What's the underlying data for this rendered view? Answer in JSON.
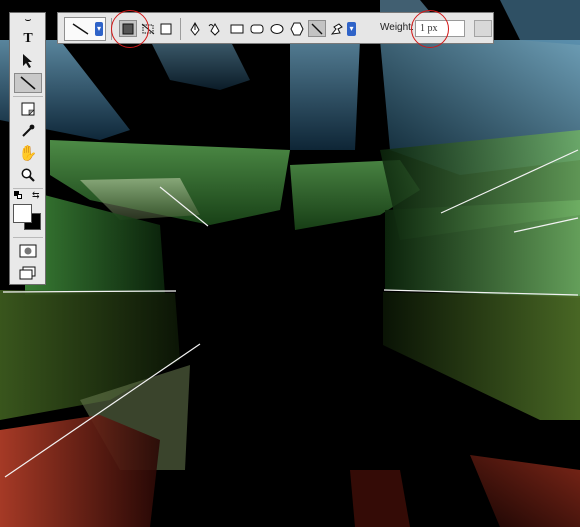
{
  "options_bar": {
    "weight_label": "Weight:",
    "weight_value": "1 px",
    "active_tool": "line-tool",
    "geometry_mode": "shape-layers"
  },
  "tools_panel": {
    "type_tool_glyph": "T",
    "active_tool": "line-tool"
  },
  "colors": {
    "highlight_ring": "#d21818",
    "panel_bg": "#e6e6e6",
    "selected_button": "#c3c3c3",
    "dropdown_accent": "#2f63c8"
  }
}
